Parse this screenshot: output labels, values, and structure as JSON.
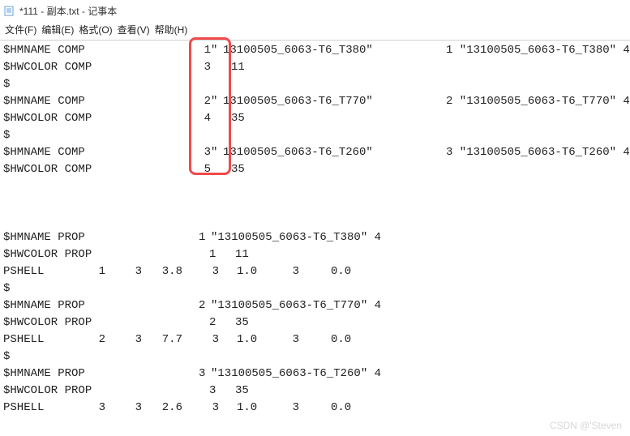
{
  "window": {
    "title": "*111 - 副本.txt - 记事本"
  },
  "menu": {
    "file": "文件(F)",
    "edit": "编辑(E)",
    "format": "格式(O)",
    "view": "查看(V)",
    "help": "帮助(H)"
  },
  "comp": [
    {
      "name_label": "$HMNAME COMP",
      "num": "1",
      "quote": "\"",
      "str": "13100505_6063-T6_T380\"",
      "right": "1 \"13100505_6063-T6_T380\" 4",
      "hw_label": "$HWCOLOR COMP",
      "hw_num": "3",
      "hw_val": "11"
    },
    {
      "name_label": "$HMNAME COMP",
      "num": "2",
      "quote": "\"",
      "str": "13100505_6063-T6_T770\"",
      "right": "2 \"13100505_6063-T6_T770\" 4",
      "hw_label": "$HWCOLOR COMP",
      "hw_num": "4",
      "hw_val": "35"
    },
    {
      "name_label": "$HMNAME COMP",
      "num": "3",
      "quote": "\"",
      "str": "13100505_6063-T6_T260\"",
      "right": "3 \"13100505_6063-T6_T260\" 4",
      "hw_label": "$HWCOLOR COMP",
      "hw_num": "5",
      "hw_val": "35"
    }
  ],
  "dollar": "$",
  "prop": [
    {
      "name_label": "$HMNAME PROP",
      "num": "1",
      "str": "\"13100505_6063-T6_T380\" 4",
      "hw_label": "$HWCOLOR PROP",
      "hw_a": "1",
      "hw_b": "11",
      "pshell_label": "PSHELL",
      "a": "1",
      "b": "3",
      "c": "3.8",
      "d": "3",
      "e": "1.0",
      "f": "3",
      "g": "0.0"
    },
    {
      "name_label": "$HMNAME PROP",
      "num": "2",
      "str": "\"13100505_6063-T6_T770\" 4",
      "hw_label": "$HWCOLOR PROP",
      "hw_a": "2",
      "hw_b": "35",
      "pshell_label": "PSHELL",
      "a": "2",
      "b": "3",
      "c": "7.7",
      "d": "3",
      "e": "1.0",
      "f": "3",
      "g": "0.0"
    },
    {
      "name_label": "$HMNAME PROP",
      "num": "3",
      "str": "\"13100505_6063-T6_T260\" 4",
      "hw_label": "$HWCOLOR PROP",
      "hw_a": "3",
      "hw_b": "35",
      "pshell_label": "PSHELL",
      "a": "3",
      "b": "3",
      "c": "2.6",
      "d": "3",
      "e": "1.0",
      "f": "3",
      "g": "0.0"
    }
  ],
  "watermark": "CSDN @'Steven"
}
